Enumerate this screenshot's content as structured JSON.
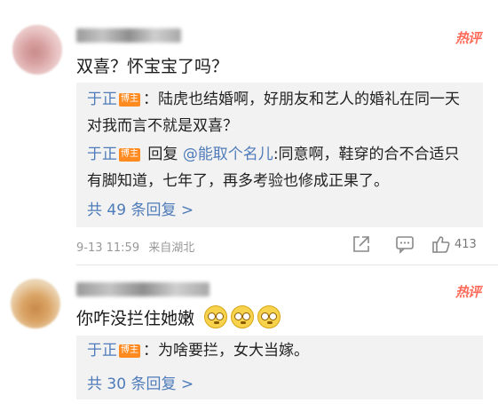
{
  "comments": [
    {
      "hot_label": "热评",
      "text": "双喜？怀宝宝了吗？",
      "replies": [
        {
          "user": "于正",
          "badge": "博主",
          "text": "：陆虎也结婚啊，好朋友和艺人的婚礼在同一天对我而言不就是双喜？"
        },
        {
          "user": "于正",
          "badge": "博主",
          "reply_word": " 回复 ",
          "mention": "@能取个名儿",
          "text": ":同意啊，鞋穿的合不合适只有脚知道，七年了，再多考验也修成正果了。"
        }
      ],
      "more_replies": "共 49 条回复 >",
      "time": "9-13 11:59",
      "location": "来自湖北",
      "actions": {
        "share_icon": "share-icon",
        "comment_icon": "comment-icon",
        "like_icon": "thumb-up-icon",
        "like_count": "413"
      }
    },
    {
      "hot_label": "热评",
      "text": "你咋没拦住她嫩",
      "emoji_icons": [
        "staring-face-emoji",
        "staring-face-emoji",
        "staring-face-emoji"
      ],
      "replies": [
        {
          "user": "于正",
          "badge": "博主",
          "text": "：为啥要拦，女大当嫁。"
        }
      ],
      "more_replies": "共 30 条回复 >"
    }
  ],
  "colors": {
    "link_blue": "#4e7bb9",
    "hot_red": "#ff6b5a",
    "badge_orange": "#ff8a1f",
    "reply_bg": "#f2f2f2",
    "meta_gray": "#999999"
  }
}
